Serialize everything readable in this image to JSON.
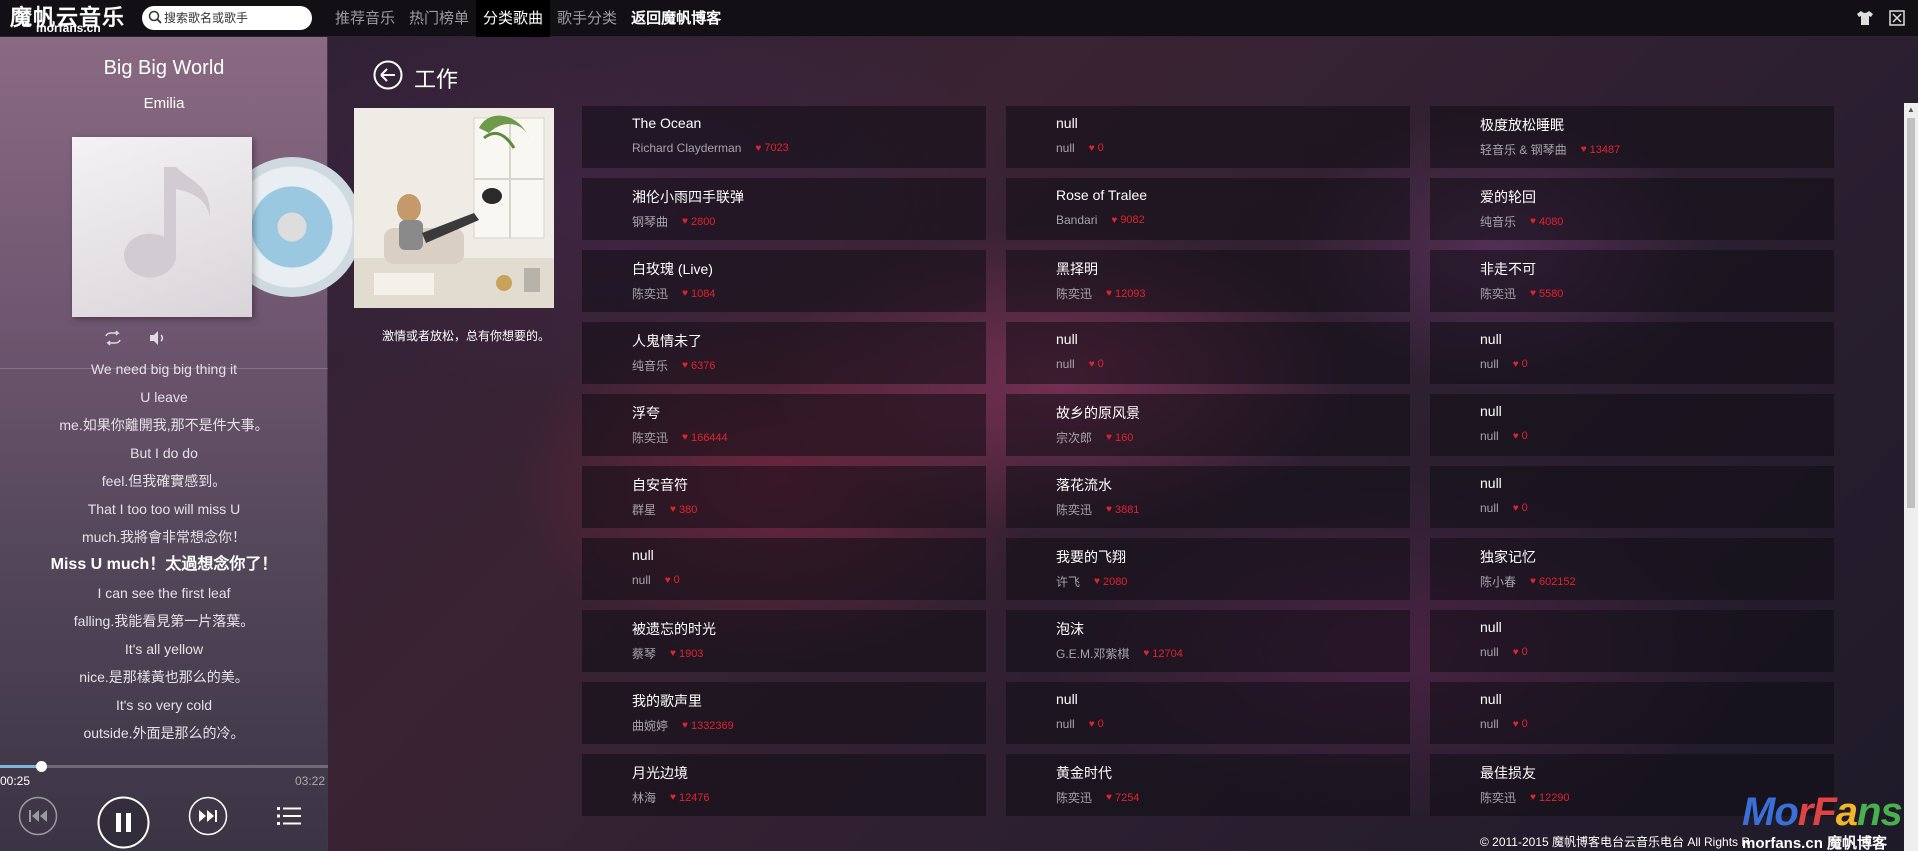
{
  "logo": {
    "cn": "魔帆云音乐",
    "en": "morfans.cn"
  },
  "search": {
    "placeholder": "搜索歌名或歌手"
  },
  "nav": [
    {
      "label": "推荐音乐"
    },
    {
      "label": "热门榜单"
    },
    {
      "label": "分类歌曲",
      "active": true
    },
    {
      "label": "歌手分类"
    },
    {
      "label": "返回魔帆博客",
      "bold": true
    }
  ],
  "player": {
    "title": "Big Big World",
    "artist": "Emilia",
    "time_current": "00:25",
    "time_total": "03:22",
    "progress": 0.124,
    "lyrics": [
      "We need big big thing it",
      "U leave",
      "me.如果你離開我,那不是件大事。",
      "But I do do",
      "feel.但我確實感到。",
      "That I too too will miss U",
      "much.我將會非常想念你！",
      "Miss U much！太過想念你了！",
      "I can see the first leaf",
      "falling.我能看見第一片落葉。",
      "It's all yellow",
      "nice.是那樣黃也那么的美。",
      "It's so very cold",
      "outside.外面是那么的冷。"
    ],
    "current_lyric_index": 7
  },
  "category": {
    "title": "工作",
    "description": "激情或者放松，总有你想要的。"
  },
  "songs": [
    {
      "name": "The Ocean",
      "artist": "Richard Clayderman",
      "likes": "7023"
    },
    {
      "name": "null",
      "artist": "null",
      "likes": "0"
    },
    {
      "name": "极度放松睡眠",
      "artist": "轻音乐 & 钢琴曲",
      "likes": "13487"
    },
    {
      "name": "湘伦小雨四手联弹",
      "artist": "钢琴曲",
      "likes": "2800"
    },
    {
      "name": "Rose of Tralee",
      "artist": "Bandari",
      "likes": "9082"
    },
    {
      "name": "爱的轮回",
      "artist": "纯音乐",
      "likes": "4080"
    },
    {
      "name": "白玫瑰 (Live)",
      "artist": "陈奕迅",
      "likes": "1084"
    },
    {
      "name": "黑择明",
      "artist": "陈奕迅",
      "likes": "12093"
    },
    {
      "name": "非走不可",
      "artist": "陈奕迅",
      "likes": "5580"
    },
    {
      "name": "人鬼情未了",
      "artist": "纯音乐",
      "likes": "6376"
    },
    {
      "name": "null",
      "artist": "null",
      "likes": "0"
    },
    {
      "name": "null",
      "artist": "null",
      "likes": "0"
    },
    {
      "name": "浮夸",
      "artist": "陈奕迅",
      "likes": "166444"
    },
    {
      "name": "故乡的原风景",
      "artist": "宗次郎",
      "likes": "160"
    },
    {
      "name": "null",
      "artist": "null",
      "likes": "0"
    },
    {
      "name": "自安音符",
      "artist": "群星",
      "likes": "380"
    },
    {
      "name": "落花流水",
      "artist": "陈奕迅",
      "likes": "3881"
    },
    {
      "name": "null",
      "artist": "null",
      "likes": "0"
    },
    {
      "name": "null",
      "artist": "null",
      "likes": "0"
    },
    {
      "name": "我要的飞翔",
      "artist": "许飞",
      "likes": "2080"
    },
    {
      "name": "独家记忆",
      "artist": "陈小春",
      "likes": "602152"
    },
    {
      "name": "被遗忘的时光",
      "artist": "蔡琴",
      "likes": "1903"
    },
    {
      "name": "泡沫",
      "artist": "G.E.M.邓紫棋",
      "likes": "12704"
    },
    {
      "name": "null",
      "artist": "null",
      "likes": "0"
    },
    {
      "name": "我的歌声里",
      "artist": "曲婉婷",
      "likes": "1332369"
    },
    {
      "name": "null",
      "artist": "null",
      "likes": "0"
    },
    {
      "name": "null",
      "artist": "null",
      "likes": "0"
    },
    {
      "name": "月光边境",
      "artist": "林海",
      "likes": "12476"
    },
    {
      "name": "黄金时代",
      "artist": "陈奕迅",
      "likes": "7254"
    },
    {
      "name": "最佳损友",
      "artist": "陈奕迅",
      "likes": "12290"
    }
  ],
  "footer": {
    "copyright": "© 2011-2015 魔帆博客电台云音乐电台 All Rights Reserved"
  },
  "watermark": {
    "brand": "MorFans",
    "site": "morfans.cn 魔帆博客"
  }
}
